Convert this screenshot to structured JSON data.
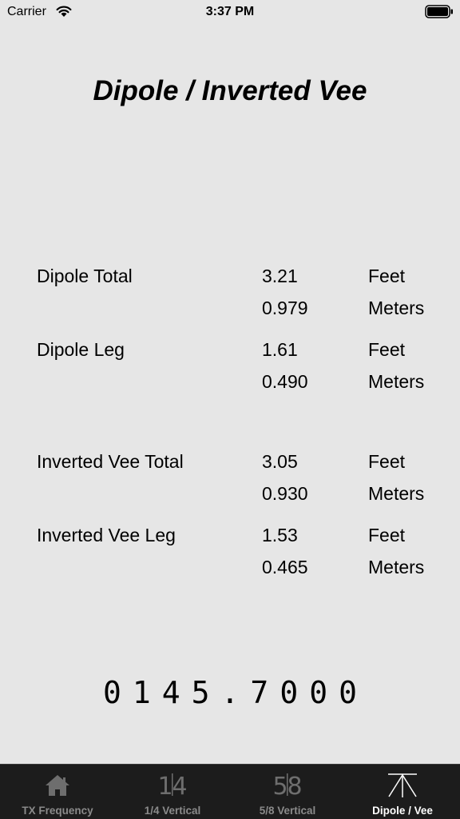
{
  "status_bar": {
    "carrier": "Carrier",
    "time": "3:37 PM"
  },
  "page": {
    "title": "Dipole / Inverted Vee"
  },
  "results": [
    {
      "label": "Dipole Total",
      "feet": "3.21",
      "meters": "0.979"
    },
    {
      "label": "Dipole Leg",
      "feet": "1.61",
      "meters": "0.490"
    },
    {
      "label": "Inverted Vee Total",
      "feet": "3.05",
      "meters": "0.930"
    },
    {
      "label": "Inverted Vee Leg",
      "feet": "1.53",
      "meters": "0.465"
    }
  ],
  "units": {
    "feet": "Feet",
    "meters": "Meters"
  },
  "frequency": "0145.7000",
  "tabs": [
    {
      "label": "TX Frequency",
      "icon": "house-icon"
    },
    {
      "label": "1/4 Vertical",
      "icon": "quarter-icon"
    },
    {
      "label": "5/8 Vertical",
      "icon": "five-eighths-icon"
    },
    {
      "label": "Dipole / Vee",
      "icon": "dipole-antenna-icon"
    }
  ],
  "active_tab": 3,
  "colors": {
    "background": "#e6e6e6",
    "tab_bar": "#1c1c1c",
    "tab_inactive": "#8a8a8a",
    "tab_active": "#ffffff"
  }
}
